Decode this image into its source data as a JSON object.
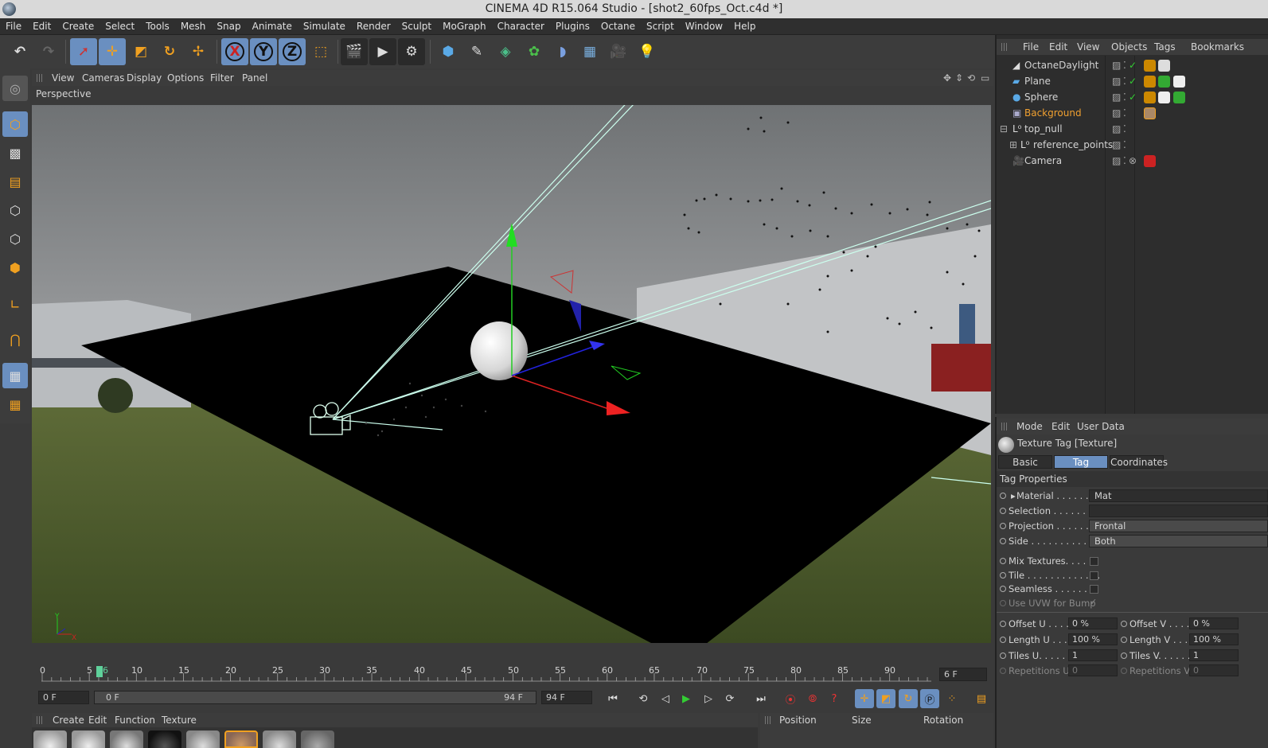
{
  "window": {
    "title": "CINEMA 4D R15.064 Studio - [shot2_60fps_Oct.c4d *]"
  },
  "menubar": [
    "File",
    "Edit",
    "Create",
    "Select",
    "Tools",
    "Mesh",
    "Snap",
    "Animate",
    "Simulate",
    "Render",
    "Sculpt",
    "MoGraph",
    "Character",
    "Plugins",
    "Octane",
    "Script",
    "Window",
    "Help"
  ],
  "toolbar": {
    "icons": [
      "undo-icon",
      "redo-icon",
      "live-selection-icon",
      "move-icon",
      "scale-icon",
      "rotate-icon",
      "recent-tool-icon",
      "x-axis-icon",
      "y-axis-icon",
      "z-axis-icon",
      "world-coordinates-icon",
      "render-view-icon",
      "render-picture-viewer-icon",
      "render-settings-icon",
      "cube-icon",
      "spline-pen-icon",
      "subdivision-surface-icon",
      "cloner-icon",
      "deformer-icon",
      "floor-icon",
      "camera-icon",
      "light-icon"
    ],
    "x_label": "X",
    "y_label": "Y",
    "z_label": "Z"
  },
  "viewport": {
    "menu": [
      "View",
      "Cameras",
      "Display",
      "Options",
      "Filter",
      "Panel"
    ],
    "label": "Perspective",
    "axis_y": "Y",
    "axis_x": "X"
  },
  "timeline": {
    "ticks": [
      "0",
      "5",
      "6",
      "10",
      "15",
      "20",
      "25",
      "30",
      "35",
      "40",
      "45",
      "50",
      "55",
      "60",
      "65",
      "70",
      "75",
      "80",
      "85",
      "90"
    ],
    "current_frame": "6 F",
    "start_field": "0 F",
    "range_start": "0 F",
    "range_end": "94 F",
    "end_field": "94 F"
  },
  "material_manager": {
    "menu": [
      "Create",
      "Edit",
      "Function",
      "Texture"
    ]
  },
  "coordinates": {
    "headers": [
      "Position",
      "Size",
      "Rotation"
    ]
  },
  "object_manager": {
    "menu": [
      "File",
      "Edit",
      "View",
      "Objects",
      "Tags",
      "Bookmarks"
    ],
    "objects": [
      {
        "name": "OctaneDaylight",
        "color": "#d4d4d4"
      },
      {
        "name": "Plane",
        "color": "#d4d4d4"
      },
      {
        "name": "Sphere",
        "color": "#d4d4d4"
      },
      {
        "name": "Background",
        "color": "#f0a030"
      },
      {
        "name": "top_null",
        "color": "#d4d4d4"
      },
      {
        "name": "reference_points",
        "color": "#d4d4d4"
      },
      {
        "name": "Camera",
        "color": "#d4d4d4"
      }
    ]
  },
  "attribute_manager": {
    "menu": [
      "Mode",
      "Edit",
      "User Data"
    ],
    "title": "Texture Tag [Texture]",
    "tabs": [
      "Basic",
      "Tag",
      "Coordinates"
    ],
    "section": "Tag Properties",
    "props": {
      "material_label": "Material . . . . . . .",
      "material_value": "Mat",
      "selection_label": "Selection . . . . . . . .",
      "selection_value": "",
      "projection_label": "Projection . . . . . . .",
      "projection_value": "Frontal",
      "side_label": "Side . . . . . . . . . . . .",
      "side_value": "Both",
      "mix_label": "Mix Textures. . . . . .",
      "tile_label": "Tile . . . . . . . . . . . . .",
      "seamless_label": "Seamless . . . . . . .",
      "uvw_label": "Use UVW for Bump",
      "offset_u_label": "Offset U . . . .",
      "offset_u_value": "0 %",
      "offset_v_label": "Offset V . . . .",
      "offset_v_value": "0 %",
      "length_u_label": "Length U . . .",
      "length_u_value": "100 %",
      "length_v_label": "Length V . . .",
      "length_v_value": "100 %",
      "tiles_u_label": "Tiles U. . . . . .",
      "tiles_u_value": "1",
      "tiles_v_label": "Tiles V. . . . . .",
      "tiles_v_value": "1",
      "rep_u_label": "Repetitions U",
      "rep_u_value": "0",
      "rep_v_label": "Repetitions V",
      "rep_v_value": "0"
    }
  }
}
